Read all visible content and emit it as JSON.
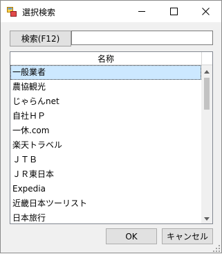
{
  "window": {
    "title": "選択検索"
  },
  "search": {
    "label": "検索(F12)",
    "value": "",
    "placeholder": ""
  },
  "grid": {
    "column_header": "名称",
    "rows": [
      "一般業者",
      "農協観光",
      "じゃらんnet",
      "自社ＨＰ",
      "一休.com",
      "楽天トラベル",
      "ＪＴＢ",
      "ＪＲ東日本",
      "Expedia",
      "近畿日本ツーリスト",
      "日本旅行"
    ],
    "selected_index": 0
  },
  "buttons": {
    "ok": "OK",
    "cancel": "キャンセル"
  },
  "icons": {
    "app": "app-window-icon",
    "minimize": "minimize-icon",
    "maximize": "maximize-icon",
    "close": "close-icon",
    "scroll_up": "chevron-up-icon",
    "scroll_down": "chevron-down-icon",
    "grip": "resize-grip-icon"
  }
}
